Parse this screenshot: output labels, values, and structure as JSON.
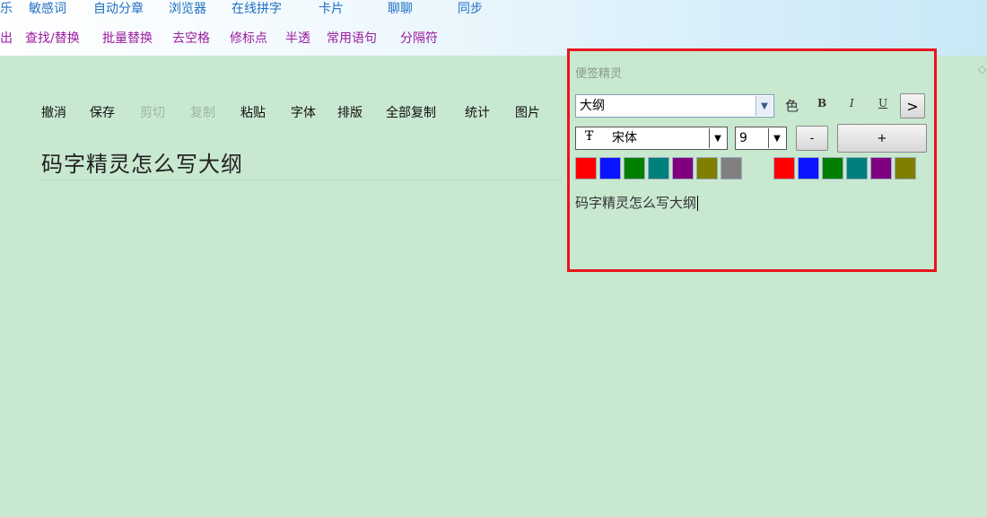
{
  "menu_row1": [
    "乐",
    "敏感词",
    "自动分章",
    "浏览器",
    "在线拼字",
    "卡片",
    "聊聊",
    "同步"
  ],
  "menu_row2": [
    "出",
    "查找/替换",
    "批量替换",
    "去空格",
    "修标点",
    "半透",
    "常用语句",
    "分隔符"
  ],
  "toolbar": {
    "undo": "撤消",
    "save": "保存",
    "cut": "剪切",
    "copy": "复制",
    "paste": "粘贴",
    "font": "字体",
    "layout": "排版",
    "copy_all": "全部复制",
    "stats": "统计",
    "image": "图片"
  },
  "document": {
    "title": "码字精灵怎么写大纲"
  },
  "sticky_panel": {
    "title": "便签精灵",
    "category_select": "大纲",
    "color_label": "色",
    "bold_label": "B",
    "italic_label": "I",
    "underline_label": "U",
    "next_label": ">",
    "font_select": "宋体",
    "size_select": "9",
    "minus_label": "-",
    "plus_label": "+",
    "text_colors": [
      "#ff0000",
      "#0a14ff",
      "#007f00",
      "#007f7f",
      "#800080",
      "#7f7f00",
      "#808080"
    ],
    "bg_colors": [
      "#ff0000",
      "#0a14ff",
      "#007f00",
      "#007f7f",
      "#800080",
      "#7f7f00"
    ],
    "note_text": "码字精灵怎么写大纲"
  },
  "colors": {
    "panel_border": "#e8141e",
    "background": "#c8e8d0",
    "menu_blue": "#1f6fc2",
    "menu_purple": "#9a1aa0"
  }
}
